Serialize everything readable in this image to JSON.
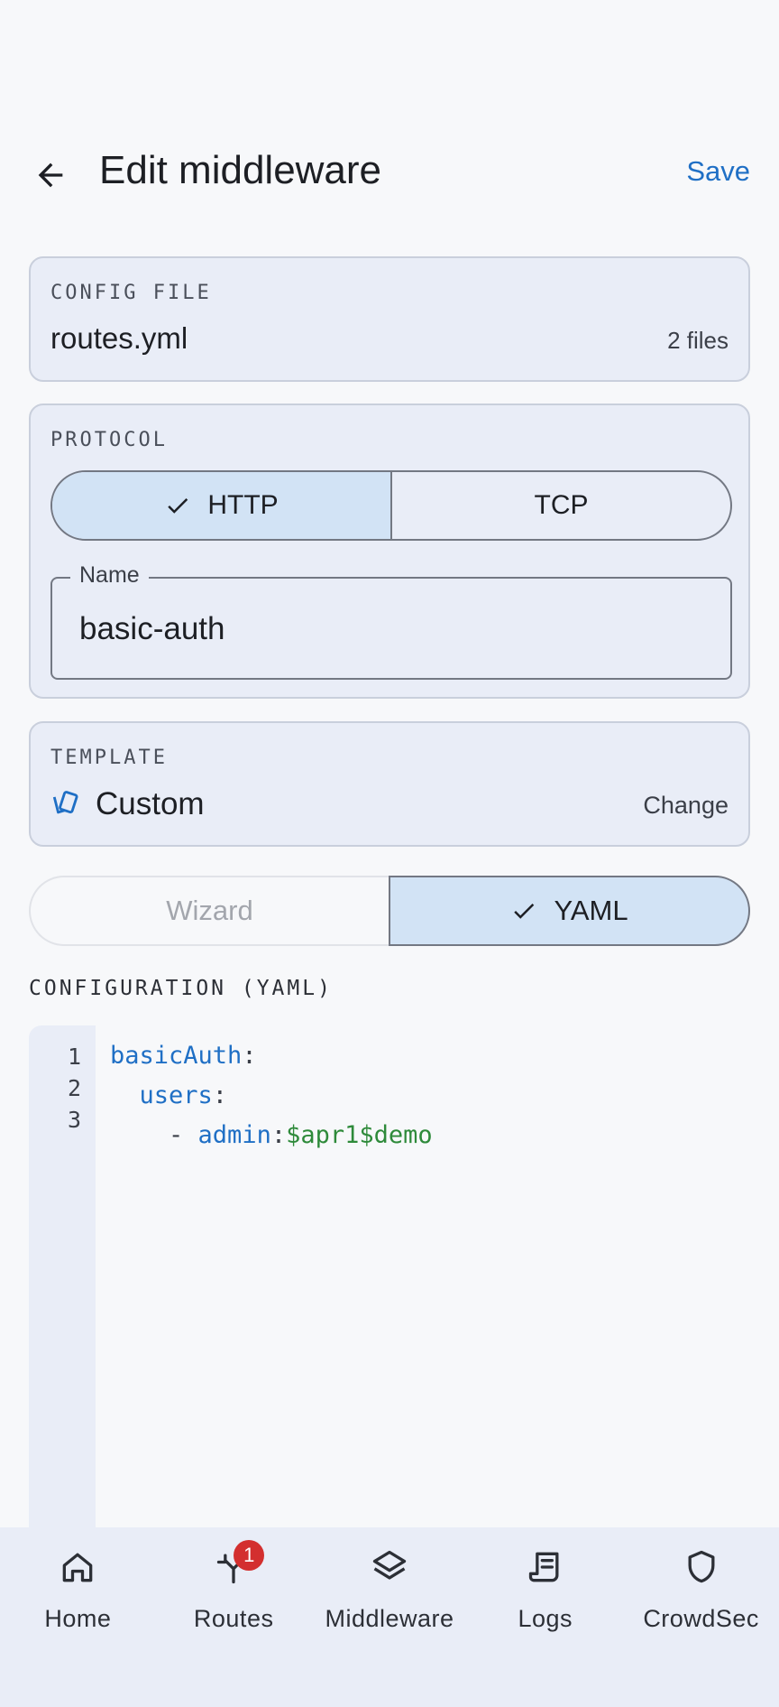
{
  "header": {
    "title": "Edit middleware",
    "save_label": "Save"
  },
  "config_file": {
    "label": "CONFIG FILE",
    "value": "routes.yml",
    "count": "2 files"
  },
  "protocol": {
    "label": "PROTOCOL",
    "options": [
      {
        "label": "HTTP",
        "selected": true
      },
      {
        "label": "TCP",
        "selected": false
      }
    ]
  },
  "name_field": {
    "label": "Name",
    "value": "basic-auth"
  },
  "template": {
    "label": "TEMPLATE",
    "value": "Custom",
    "icon": "template-icon",
    "change_label": "Change"
  },
  "mode": {
    "options": [
      {
        "label": "Wizard",
        "selected": false
      },
      {
        "label": "YAML",
        "selected": true
      }
    ]
  },
  "editor": {
    "heading": "CONFIGURATION (YAML)",
    "lines": [
      {
        "num": "1",
        "indent": "",
        "key": "basicAuth",
        "sep": ":",
        "value": ""
      },
      {
        "num": "2",
        "indent": "  ",
        "key": "users",
        "sep": ":",
        "value": ""
      },
      {
        "num": "3",
        "indent": "    - ",
        "key": "admin",
        "sep": ":",
        "value": "$apr1$demo"
      }
    ]
  },
  "bottom_nav": {
    "items": [
      {
        "label": "Home",
        "icon": "home-icon"
      },
      {
        "label": "Routes",
        "icon": "routes-icon",
        "badge": "1"
      },
      {
        "label": "Middleware",
        "icon": "layers-icon"
      },
      {
        "label": "Logs",
        "icon": "logs-icon"
      },
      {
        "label": "CrowdSec",
        "icon": "shield-icon"
      }
    ]
  },
  "colors": {
    "accent": "#1f6fc5",
    "selected_bg": "#d2e3f5",
    "card_bg": "#e9edf7",
    "badge": "#d32f2f",
    "yaml_key": "#1f6fc5",
    "yaml_value": "#2e8a3a"
  }
}
